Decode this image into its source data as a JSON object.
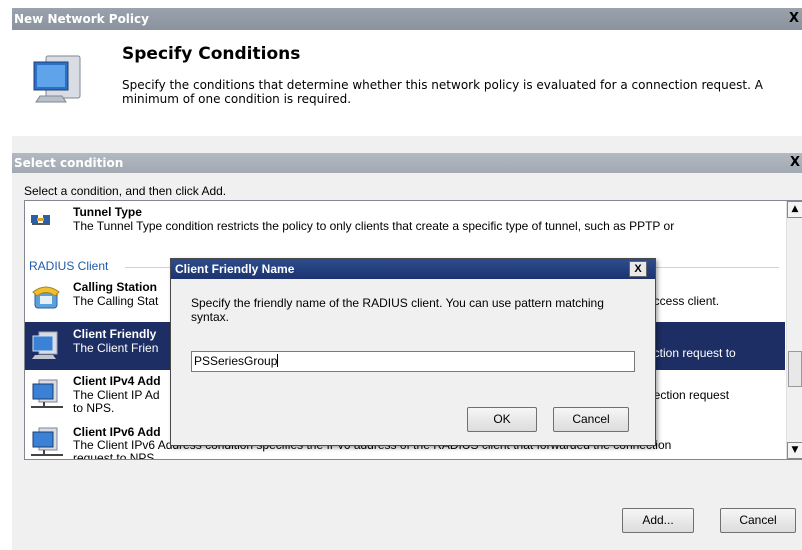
{
  "window": {
    "title": "New Network Policy",
    "close_glyph": "X",
    "heading": "Specify Conditions",
    "description": "Specify the conditions that determine whether this network policy is evaluated for a connection request. A minimum of one condition is required."
  },
  "select_dialog": {
    "title": "Select condition",
    "close_glyph": "X",
    "instruction": "Select a condition, and then click Add.",
    "list": {
      "tunnel": {
        "title": "Tunnel Type",
        "desc": "The Tunnel Type condition restricts the policy to only clients that create a specific type of tunnel, such as PPTP or"
      },
      "group_header": "RADIUS Client",
      "calling": {
        "title": "Calling Station",
        "desc_left": "The Calling Stat",
        "desc_right": "access client."
      },
      "friendly": {
        "title": "Client Friendly",
        "desc_left": "The Client Frien",
        "desc_right": "ection request to"
      },
      "ipv4": {
        "title": "Client IPv4 Add",
        "desc_left": "The Client IP Ad",
        "desc_right": "nection request",
        "desc_line2": "to NPS."
      },
      "ipv6": {
        "title": "Client IPv6 Add",
        "desc": "The Client IPv6 Address condition specifies the IPv6 address of the RADIUS client that forwarded the connection",
        "desc_line2": "request to NPS."
      }
    },
    "buttons": {
      "add": "Add...",
      "cancel": "Cancel"
    }
  },
  "popup": {
    "title": "Client Friendly Name",
    "close_glyph": "X",
    "description": "Specify the friendly name of the RADIUS client. You can use pattern matching syntax.",
    "input_value": "PSSeriesGroup",
    "buttons": {
      "ok": "OK",
      "cancel": "Cancel"
    }
  },
  "icons": {
    "header": "computer-monitor-icon",
    "tunnel": "network-tunnel-icon",
    "calling": "phone-icon",
    "friendly": "computer-icon",
    "ipv4": "network-computer-icon",
    "ipv6": "network-computer-icon"
  },
  "colors": {
    "selection": "#1c2e63",
    "popup_title": "#2e4c8c",
    "group_header": "#1d5aa9"
  }
}
